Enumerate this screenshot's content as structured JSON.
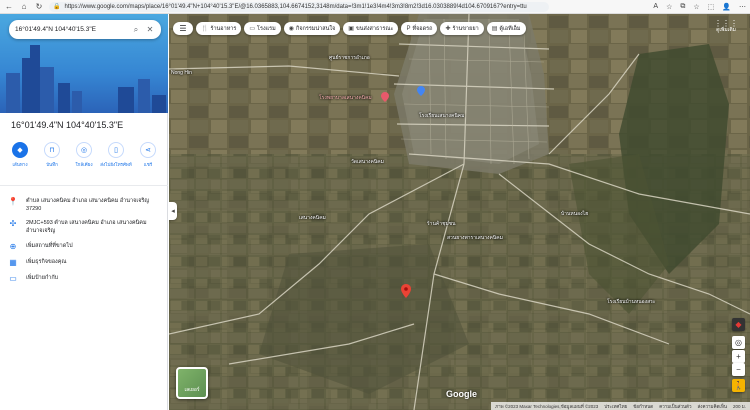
{
  "browser": {
    "url": "https://www.google.com/maps/place/16°01'49.4\"N+104°40'15.3\"E/@16.0365883,104.6674152,3148m/data=!3m1!1e3!4m4!3m3!8m2!3d16.0303889!4d104.6709167?entry=ttu",
    "back_icon": "←",
    "home_icon": "⌂",
    "refresh_icon": "↻",
    "right_icons": [
      "A",
      "☆",
      "⧉",
      "☆",
      "⬚",
      "👤",
      "⋯"
    ]
  },
  "sidebar": {
    "search_query": "16°01'49.4\"N 104°40'15.3\"E",
    "search_icon": "⌕",
    "close_icon": "✕",
    "place_title": "16°01'49.4\"N 104°40'15.3\"E",
    "actions": [
      {
        "label": "เส้นทาง",
        "icon": "◆",
        "name": "directions"
      },
      {
        "label": "บันทึก",
        "icon": "⊓",
        "name": "save"
      },
      {
        "label": "ใกล้เคียง",
        "icon": "◎",
        "name": "nearby"
      },
      {
        "label": "ส่งไปยังโทรศัพท์",
        "icon": "▯",
        "name": "send-to-phone"
      },
      {
        "label": "แชร์",
        "icon": "⋖",
        "name": "share"
      }
    ],
    "address": "ตำบล เสนางคนิคม อำเภอ เสนางคนิคม อำนาจเจริญ 37290",
    "plus_code": "2MJC+593 ตำบล เสนางคนิคม อำเภอ เสนางคนิคม อำนาจเจริญ",
    "add_missing_place": "เพิ่มสถานที่ที่ขาดไป",
    "add_business": "เพิ่มธุรกิจของคุณ",
    "add_label": "เพิ่มป้ายกำกับ"
  },
  "map": {
    "chips": [
      {
        "label": "ร้านอาหาร",
        "icon": "🍴"
      },
      {
        "label": "โรงแรม",
        "icon": "▭"
      },
      {
        "label": "กิจกรรมน่าสนใจ",
        "icon": "◉"
      },
      {
        "label": "ขนส่งสาธารณะ",
        "icon": "▣"
      },
      {
        "label": "ที่จอดรถ",
        "icon": "P"
      },
      {
        "label": "ร้านขายยา",
        "icon": "✚"
      },
      {
        "label": "ตู้เอทีเอ็ม",
        "icon": "▤"
      }
    ],
    "menu_icon": "☰",
    "apps_label": "ดูเพิ่มเติม",
    "labels": [
      {
        "text": "Nong Hin",
        "name": "label-nong-hin"
      },
      {
        "text": "ศูนย์ราชการอำเภอ",
        "name": "label-gov-center"
      },
      {
        "text": "โรงพยาบาลเสนางคนิคม",
        "name": "label-hospital"
      },
      {
        "text": "โรงเรียนเสนางคนิคม",
        "name": "label-school"
      },
      {
        "text": "วัดเสนางคนิคม",
        "name": "label-temple"
      },
      {
        "text": "เสนางคนิคม",
        "name": "label-senangkhanikhom"
      },
      {
        "text": "ร้านค้าชุมชน",
        "name": "label-community-shop"
      },
      {
        "text": "สวนยางพาราเสนางคนิคม",
        "name": "label-rubber-garden"
      },
      {
        "text": "บ้านหนองไฮ",
        "name": "label-ban-nong-hai"
      },
      {
        "text": "โรงเรียนบ้านหนองสระ",
        "name": "label-school-2"
      }
    ],
    "layers_label": "เลเยอร์",
    "google_logo": "Google",
    "attribution": [
      "ภาพ ©2023 Maxar Technologies,ข้อมูลแผนที่ ©2023",
      "ประเทศไทย",
      "ข้อกำหนด",
      "ความเป็นส่วนตัว",
      "ส่งความคิดเห็น",
      "200 ม."
    ],
    "controls": {
      "compass": "◆",
      "zoom_in": "+",
      "zoom_out": "−",
      "pegman": "🚶",
      "locate": "◎"
    },
    "collapse_icon": "◂"
  }
}
